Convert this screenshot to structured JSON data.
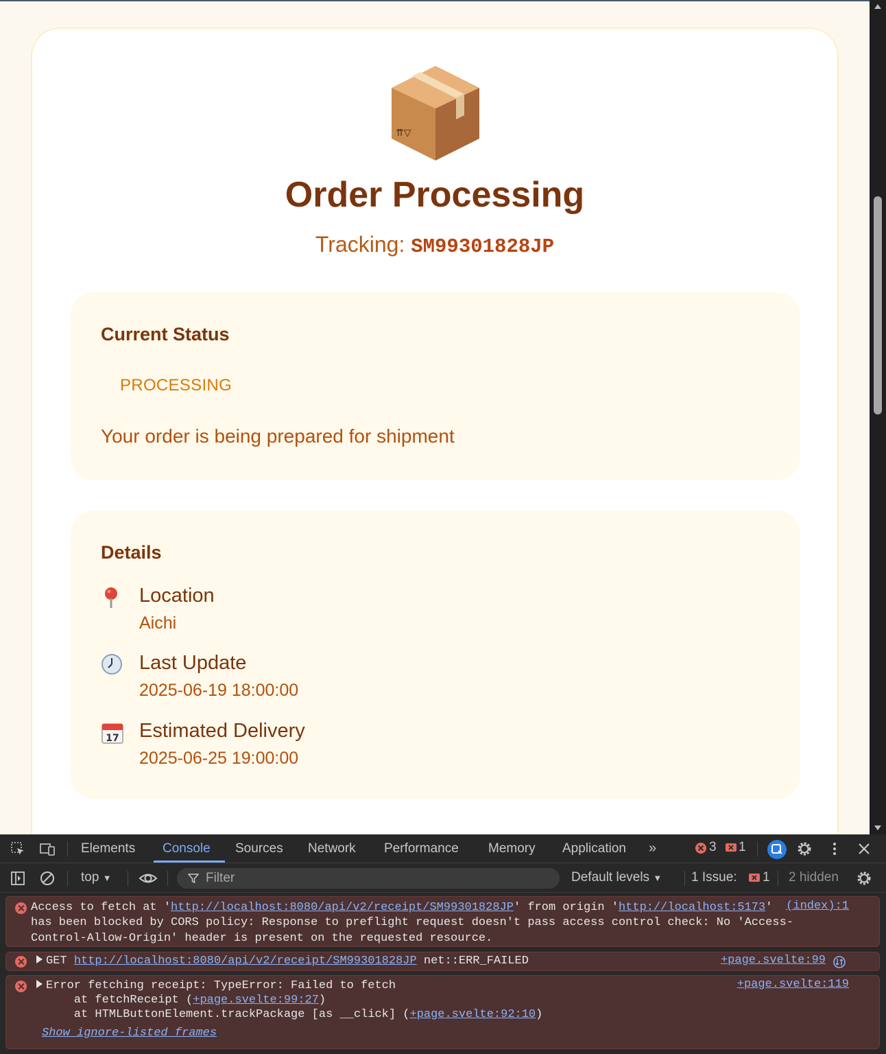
{
  "page": {
    "title": "Order Processing",
    "tracking_label": "Tracking:",
    "tracking_code": "SM99301828JP",
    "status_heading": "Current Status",
    "status_badge": "PROCESSING",
    "status_message": "Your order is being prepared for shipment",
    "details_heading": "Details",
    "details": [
      {
        "icon": "pin-icon",
        "label": "Location",
        "value": "Aichi"
      },
      {
        "icon": "clock-icon",
        "label": "Last Update",
        "value": "2025-06-19 18:00:00"
      },
      {
        "icon": "calendar-icon",
        "label": "Estimated Delivery",
        "value": "2025-06-25 19:00:00"
      }
    ],
    "calendar_day": "17",
    "colors": {
      "title": "#7a350e",
      "accent": "#b3500e",
      "badge": "#d9790a",
      "panel": "#fffaeb"
    }
  },
  "devtools": {
    "tabs": [
      "Elements",
      "Console",
      "Sources",
      "Network",
      "Performance",
      "Memory",
      "Application"
    ],
    "active_tab": "Console",
    "error_count": "3",
    "issue_count_badge": "1",
    "context": "top",
    "filter_placeholder": "Filter",
    "levels": "Default levels",
    "issues_label": "1 Issue:",
    "issues_count": "1",
    "hidden": "2 hidden",
    "messages": {
      "m1": {
        "p1": "Access to fetch at '",
        "url1": "http://localhost:8080/api/v2/receipt/SM99301828JP",
        "p2": "' from origin '",
        "url2": "http://localhost:5173",
        "p3": "'",
        "line2": "has been blocked by CORS policy: Response to preflight request doesn't pass access control check: No 'Access-",
        "line3": "Control-Allow-Origin' header is present on the requested resource.",
        "source": "(index):1"
      },
      "m2": {
        "method": "GET ",
        "url": "http://localhost:8080/api/v2/receipt/SM99301828JP",
        "status": " net::ERR_FAILED",
        "source": "+page.svelte:99"
      },
      "m3": {
        "line1": "Error fetching receipt: TypeError: Failed to fetch",
        "l2a": "    at fetchReceipt (",
        "l2link": "+page.svelte:99:27",
        "l2b": ")",
        "l3a": "    at HTMLButtonElement.trackPackage [as __click] (",
        "l3link": "+page.svelte:92:10",
        "l3b": ")",
        "show": "Show ignore-listed frames",
        "source": "+page.svelte:119"
      }
    }
  }
}
